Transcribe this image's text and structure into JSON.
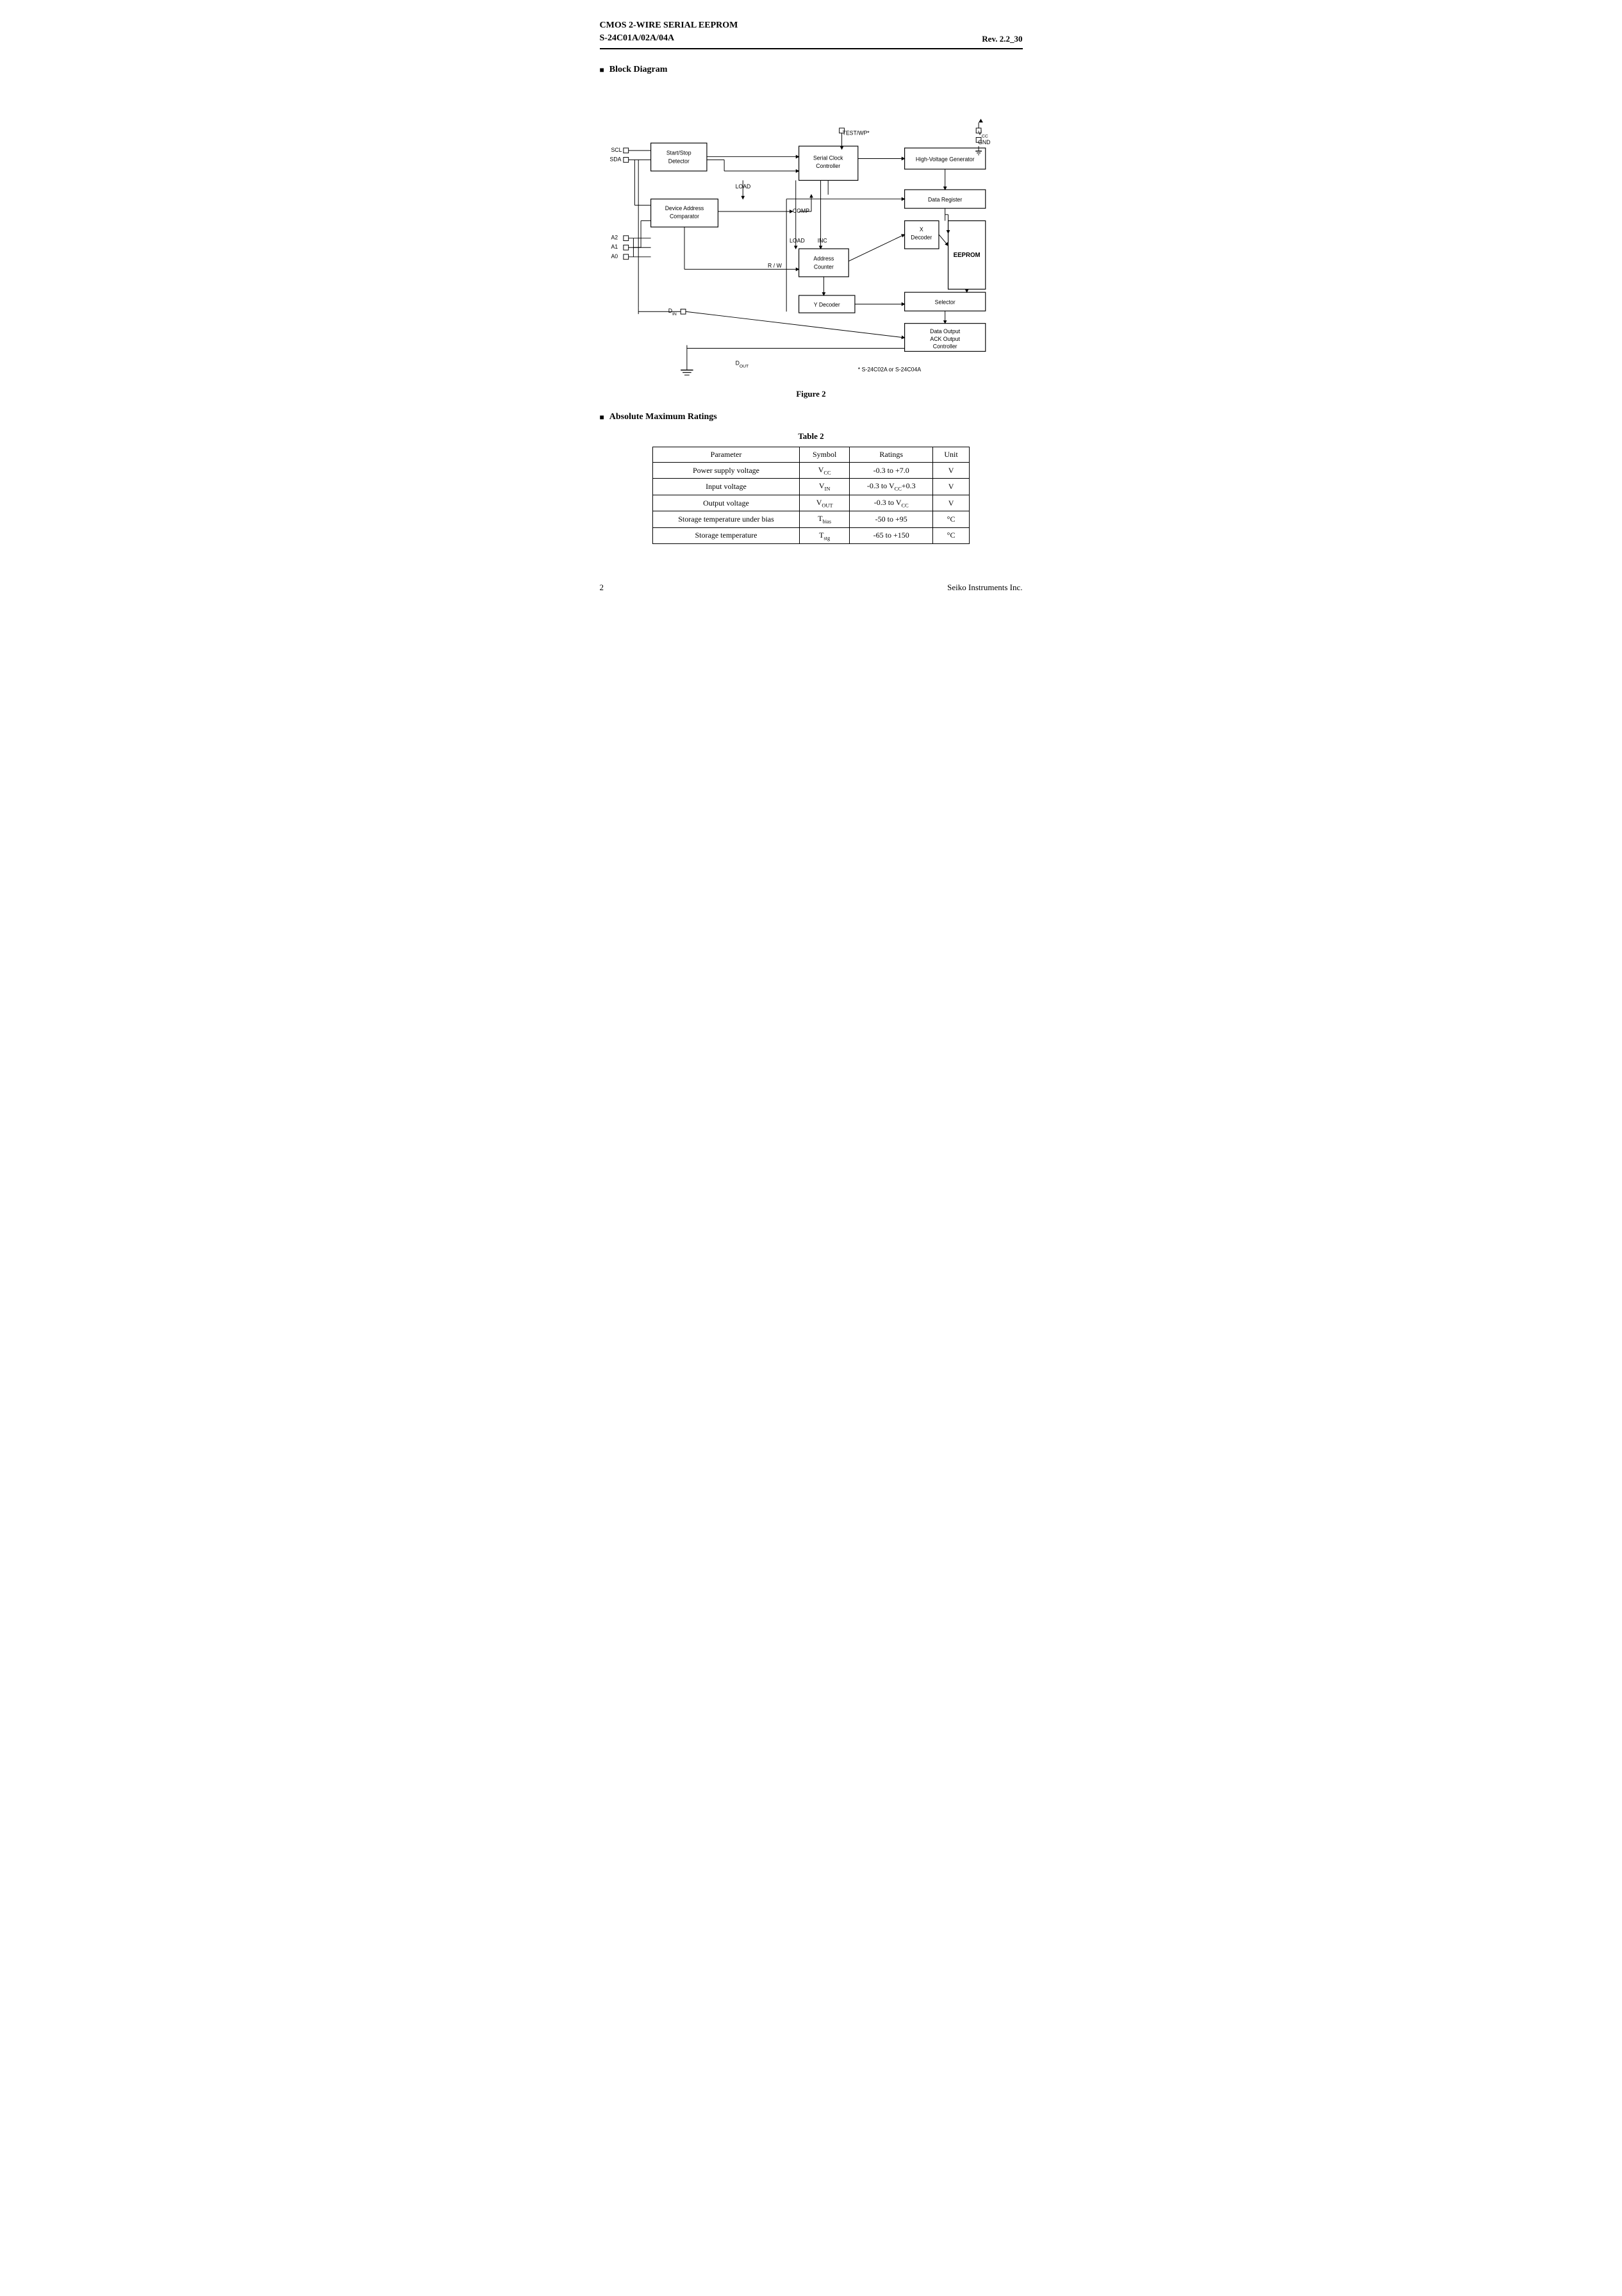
{
  "header": {
    "title_line1": "CMOS 2-WIRE SERIAL  EEPROM",
    "title_line2": "S-24C01A/02A/04A",
    "rev": "Rev. 2.2",
    "page_suffix": "_30"
  },
  "section_block_diagram": {
    "label": "Block Diagram"
  },
  "figure_caption": "Figure 2",
  "section_ratings": {
    "label": "Absolute Maximum Ratings"
  },
  "table_title": "Table  2",
  "table": {
    "headers": [
      "Parameter",
      "Symbol",
      "Ratings",
      "Unit"
    ],
    "rows": [
      [
        "Power supply voltage",
        "V_CC",
        "-0.3 to +7.0",
        "V"
      ],
      [
        "Input voltage",
        "V_IN",
        "-0.3 to V_CC+0.3",
        "V"
      ],
      [
        "Output voltage",
        "V_OUT",
        "-0.3 to V_CC",
        "V"
      ],
      [
        "Storage temperature under bias",
        "T_bias",
        "-50 to +95",
        "°C"
      ],
      [
        "Storage temperature",
        "T_stg",
        "-65 to +150",
        "°C"
      ]
    ]
  },
  "footnote": "* S-24C02A or S-24C04A",
  "footer": {
    "page_number": "2",
    "company": "Seiko Instruments Inc."
  }
}
